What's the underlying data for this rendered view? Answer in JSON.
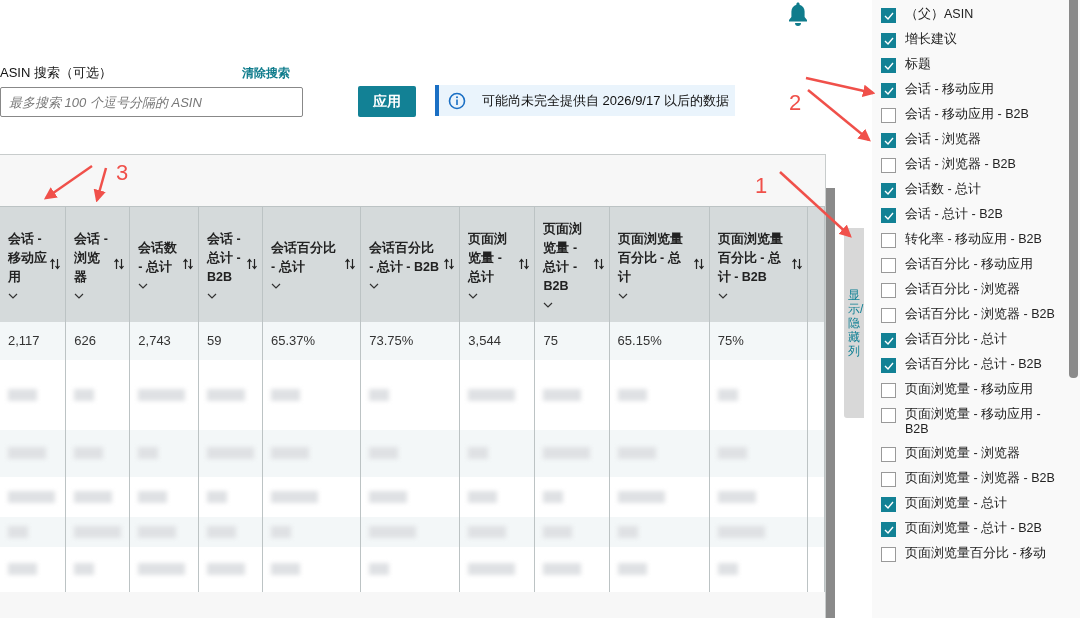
{
  "search": {
    "label": "ASIN 搜索（可选）",
    "clear_link": "清除搜索",
    "placeholder": "最多搜索 100 个逗号分隔的 ASIN",
    "apply_button": "应用"
  },
  "notice": {
    "text": "可能尚未完全提供自 2026/9/17 以后的数据"
  },
  "table": {
    "columns": [
      {
        "label": "会话 - 移动应用"
      },
      {
        "label": "会话 - 浏览器"
      },
      {
        "label": "会话数 - 总计"
      },
      {
        "label": "会话 - 总计 - B2B"
      },
      {
        "label": "会话百分比 - 总计"
      },
      {
        "label": "会话百分比 - 总计 - B2B"
      },
      {
        "label": "页面浏览量 - 总计"
      },
      {
        "label": "页面浏览量 - 总计 - B2B"
      },
      {
        "label": "页面浏览量百分比 - 总计"
      },
      {
        "label": "页面浏览量百分比 - 总计 - B2B"
      }
    ],
    "rows": [
      {
        "redacted": false,
        "cells": [
          "2,117",
          "626",
          "2,743",
          "59",
          "65.37%",
          "73.75%",
          "3,544",
          "75",
          "65.15%",
          "75%"
        ]
      },
      {
        "redacted": true
      },
      {
        "redacted": true
      },
      {
        "redacted": true
      },
      {
        "redacted": true
      },
      {
        "redacted": true
      }
    ]
  },
  "column_toggle": {
    "label": "显示/隐藏列"
  },
  "column_list": [
    {
      "label": "（父）ASIN",
      "checked": true
    },
    {
      "label": "增长建议",
      "checked": true
    },
    {
      "label": "标题",
      "checked": true
    },
    {
      "label": "会话 - 移动应用",
      "checked": true
    },
    {
      "label": "会话 - 移动应用 - B2B",
      "checked": false
    },
    {
      "label": "会话 - 浏览器",
      "checked": true
    },
    {
      "label": "会话 - 浏览器 - B2B",
      "checked": false
    },
    {
      "label": "会话数 - 总计",
      "checked": true
    },
    {
      "label": "会话 - 总计 - B2B",
      "checked": true
    },
    {
      "label": "转化率 - 移动应用 - B2B",
      "checked": false
    },
    {
      "label": "会话百分比 - 移动应用",
      "checked": false
    },
    {
      "label": "会话百分比 - 浏览器",
      "checked": false
    },
    {
      "label": "会话百分比 - 浏览器 - B2B",
      "checked": false
    },
    {
      "label": "会话百分比 - 总计",
      "checked": true
    },
    {
      "label": "会话百分比 - 总计 - B2B",
      "checked": true
    },
    {
      "label": "页面浏览量 - 移动应用",
      "checked": false
    },
    {
      "label": "页面浏览量 - 移动应用 - B2B",
      "checked": false
    },
    {
      "label": "页面浏览量 - 浏览器",
      "checked": false
    },
    {
      "label": "页面浏览量 - 浏览器 - B2B",
      "checked": false
    },
    {
      "label": "页面浏览量 - 总计",
      "checked": true
    },
    {
      "label": "页面浏览量 - 总计 - B2B",
      "checked": true
    },
    {
      "label": "页面浏览量百分比 - 移动",
      "checked": false
    }
  ],
  "annotations": [
    {
      "label": "1"
    },
    {
      "label": "2"
    },
    {
      "label": "3"
    }
  ]
}
